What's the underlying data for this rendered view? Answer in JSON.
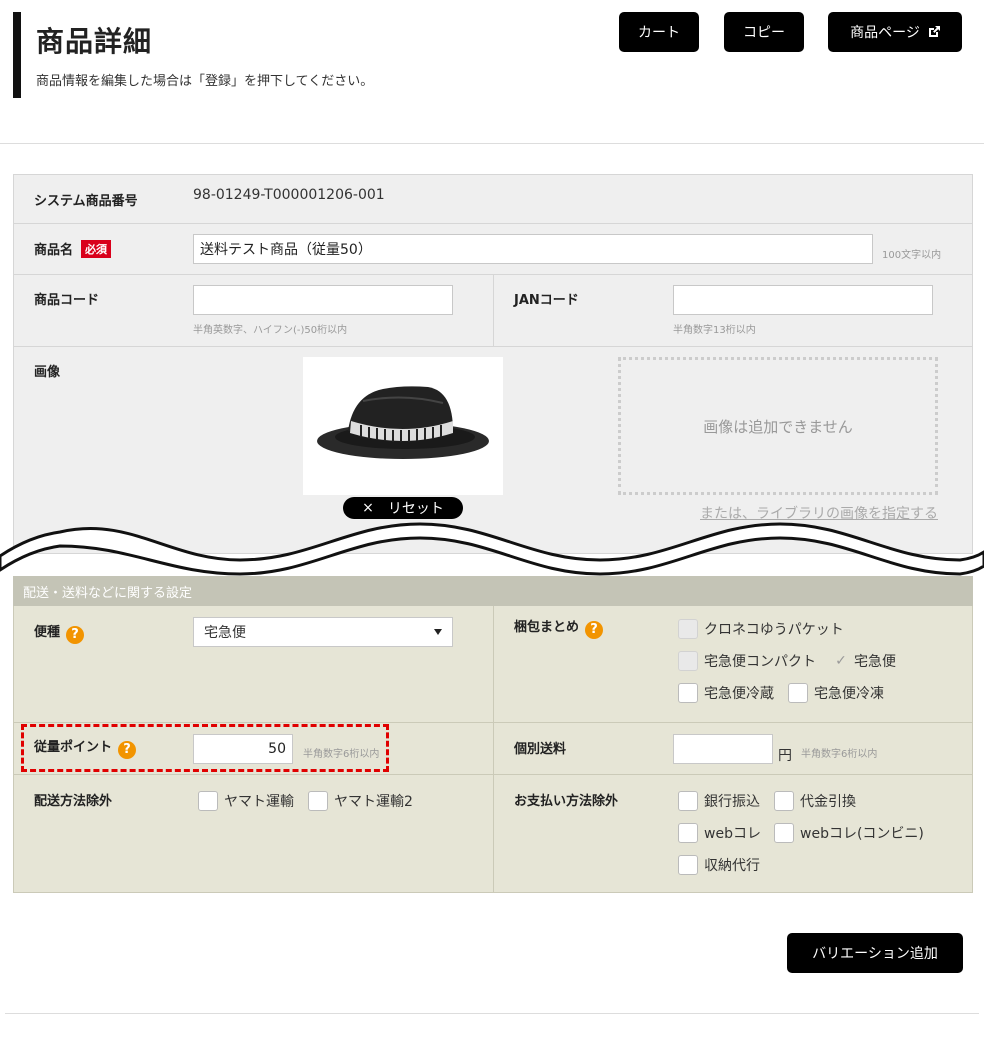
{
  "header": {
    "title": "商品詳細",
    "subtitle": "商品情報を編集した場合は「登録」を押下してください。",
    "buttons": {
      "cart": "カート",
      "copy": "コピー",
      "item_page": "商品ページ"
    }
  },
  "product": {
    "system_no_label": "システム商品番号",
    "system_no": "98-01249-T000001206-001",
    "name_label": "商品名",
    "required_badge": "必須",
    "name_value": "送料テスト商品（従量50）",
    "name_hint": "100文字以内",
    "code_label": "商品コード",
    "code_value": "",
    "code_hint": "半角英数字、ハイフン(-)50桁以内",
    "jan_label": "JANコード",
    "jan_value": "",
    "jan_hint": "半角数字13桁以内",
    "image_label": "画像",
    "reset_label": "リセット",
    "reset_icon": "×",
    "no_add_text": "画像は追加できません",
    "library_link": "または、ライブラリの画像を指定する"
  },
  "shipping": {
    "section_title": "配送・送料などに関する設定",
    "type_label": "便種",
    "type_value": "宅急便",
    "packing_label": "梱包まとめ",
    "packing_options": [
      {
        "label": "クロネコゆうパケット",
        "state": "disabled"
      },
      {
        "label": "宅急便コンパクト",
        "state": "disabled"
      },
      {
        "label": "宅急便",
        "state": "checked"
      },
      {
        "label": "宅急便冷蔵",
        "state": "unchecked"
      },
      {
        "label": "宅急便冷凍",
        "state": "unchecked"
      }
    ],
    "points_label": "従量ポイント",
    "points_value": "50",
    "points_hint": "半角数字6桁以内",
    "individual_label": "個別送料",
    "individual_value": "",
    "individual_unit": "円",
    "individual_hint": "半角数字6桁以内",
    "exclude_delivery_label": "配送方法除外",
    "exclude_delivery_options": [
      "ヤマト運輸",
      "ヤマト運輸2"
    ],
    "exclude_payment_label": "お支払い方法除外",
    "exclude_payment_options": [
      "銀行振込",
      "代金引換",
      "webコレ",
      "webコレ(コンビニ)",
      "収納代行"
    ],
    "help_icon": "?",
    "check_mark": "✓"
  },
  "footer": {
    "add_variation": "バリエーション追加"
  },
  "colors": {
    "accent_black": "#000000",
    "required_red": "#d9001b",
    "help_orange": "#f29400",
    "highlight_red": "#e00000"
  }
}
